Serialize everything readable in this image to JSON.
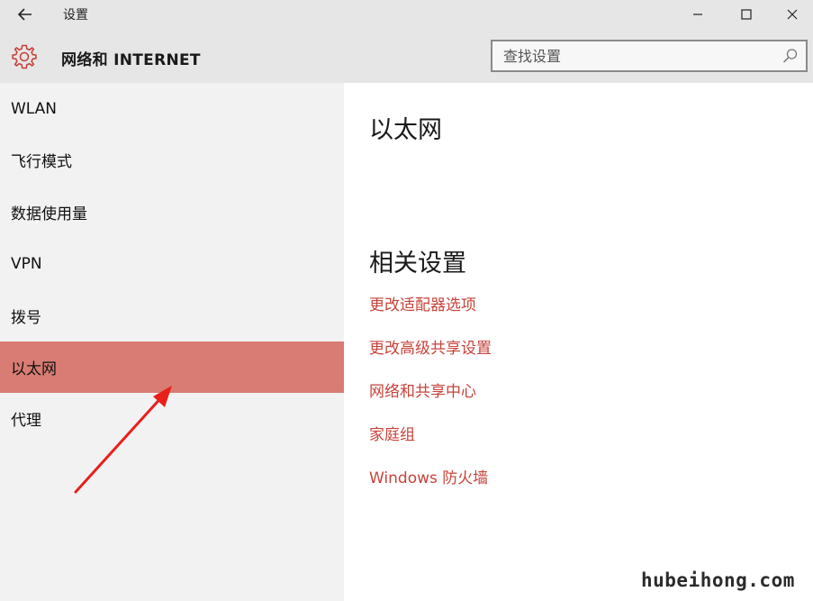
{
  "window": {
    "title": "设置",
    "back_icon": "back-arrow-icon",
    "controls": [
      "minimize-icon",
      "maximize-icon",
      "close-icon"
    ]
  },
  "header": {
    "icon": "gear-icon",
    "section_title": "网络和 INTERNET",
    "search_placeholder": "查找设置",
    "search_value": ""
  },
  "sidebar": {
    "items": [
      {
        "label": "WLAN",
        "active": false
      },
      {
        "label": "飞行模式",
        "active": false
      },
      {
        "label": "数据使用量",
        "active": false
      },
      {
        "label": "VPN",
        "active": false
      },
      {
        "label": "拨号",
        "active": false
      },
      {
        "label": "以太网",
        "active": true
      },
      {
        "label": "代理",
        "active": false
      }
    ]
  },
  "main": {
    "heading": "以太网",
    "related_heading": "相关设置",
    "links": [
      "更改适配器选项",
      "更改高级共享设置",
      "网络和共享中心",
      "家庭组",
      "Windows 防火墙"
    ]
  },
  "colors": {
    "accent": "#c7433a",
    "selection": "#d97c73",
    "sidebar_bg": "#f2f2f2",
    "titlebar_bg": "#e6e6e6",
    "arrow": "#e8201a"
  },
  "watermark": "hubeihong.com"
}
